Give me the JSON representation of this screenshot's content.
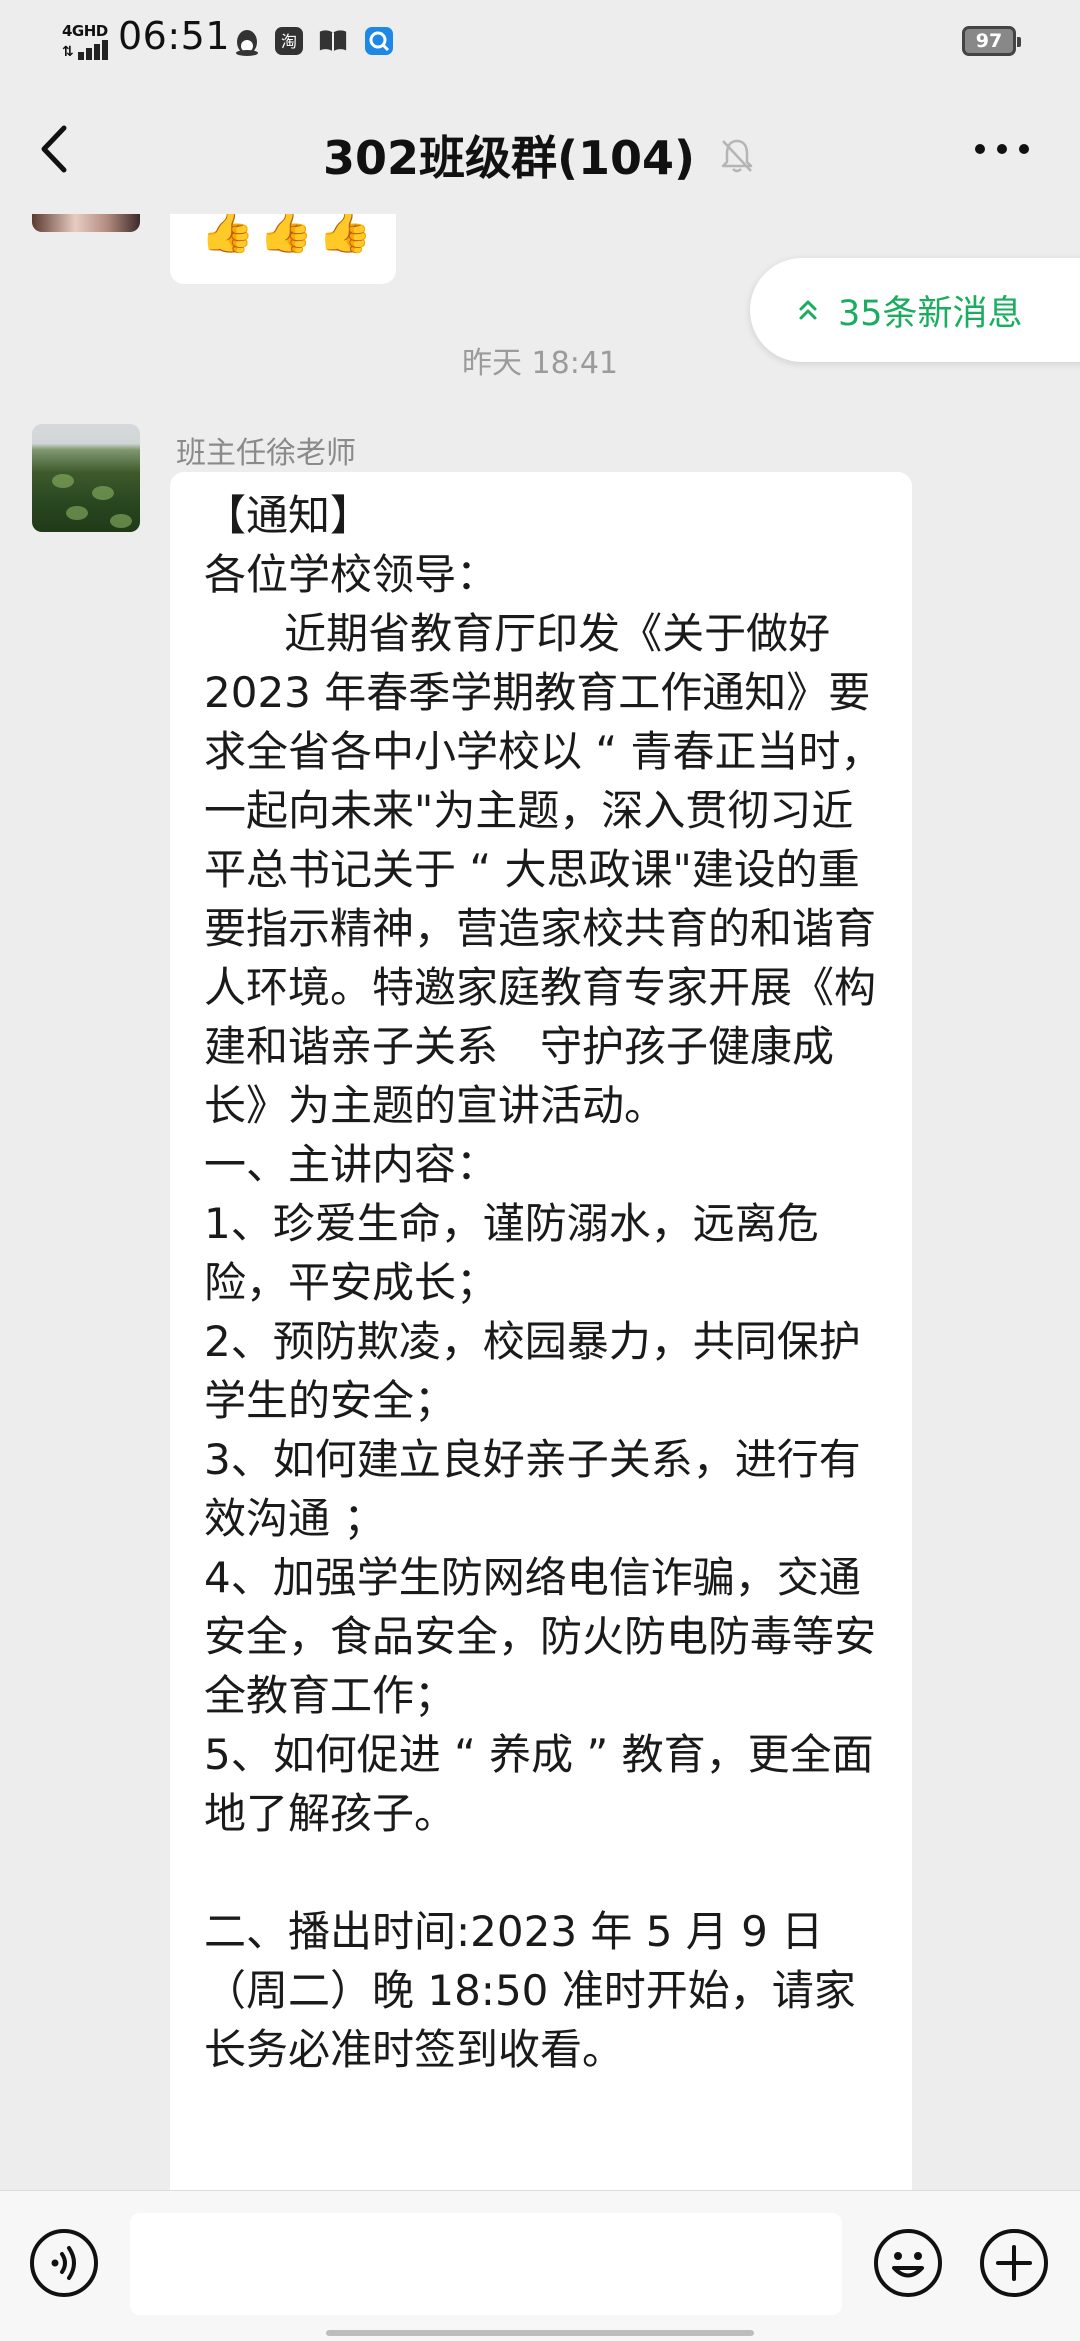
{
  "status_bar": {
    "network": "4GHD",
    "time": "06:51",
    "battery": "97",
    "icons": [
      "qq-penguin-icon",
      "taobao-icon",
      "book-icon",
      "browser-icon"
    ]
  },
  "header": {
    "title": "302班级群(104)",
    "back_icon": "chevron-left-icon",
    "mute_icon": "bell-off-icon",
    "more_icon": "more-dots-icon"
  },
  "chat": {
    "previous_message": "👍👍👍",
    "new_messages_label": "35条新消息",
    "timestamp": "昨天 18:41",
    "message": {
      "sender": "班主任徐老师",
      "lines": [
        "【通知】",
        "各位学校领导：",
        "      近期省教育厅印发《关于做好 2023 年春季学期教育工作通知》要求全省各中小学校以 “ 青春正当时，一起向未来\"为主题，深入贯彻习近平总书记关于 “ 大思政课\"建设的重要指示精神，营造家校共育的和谐育人环境。特邀家庭教育专家开展《构建和谐亲子关系　守护孩子健康成长》为主题的宣讲活动。",
        "一、主讲内容：",
        "1、珍爱生命，谨防溺水，远离危险，平安成长；",
        "2、预防欺凌，校园暴力，共同保护学生的安全；",
        "3、如何建立良好亲子关系，进行有效沟通 ；",
        "4、加强学生防网络电信诈骗，交通安全，食品安全，防火防电防毒等安全教育工作；",
        "5、如何促进 “ 养成 ” 教育，更全面地了解孩子。",
        "",
        "二、播出时间:2023 年 5 月 9 日（周二）晚 18:50 准时开始，请家长务必准时签到收看。"
      ]
    }
  },
  "input_bar": {
    "placeholder": "",
    "voice_icon": "voice-icon",
    "emoji_icon": "emoji-icon",
    "plus_icon": "plus-icon"
  },
  "colors": {
    "background": "#ededed",
    "accent_green": "#1aad5f",
    "bubble": "#ffffff"
  }
}
